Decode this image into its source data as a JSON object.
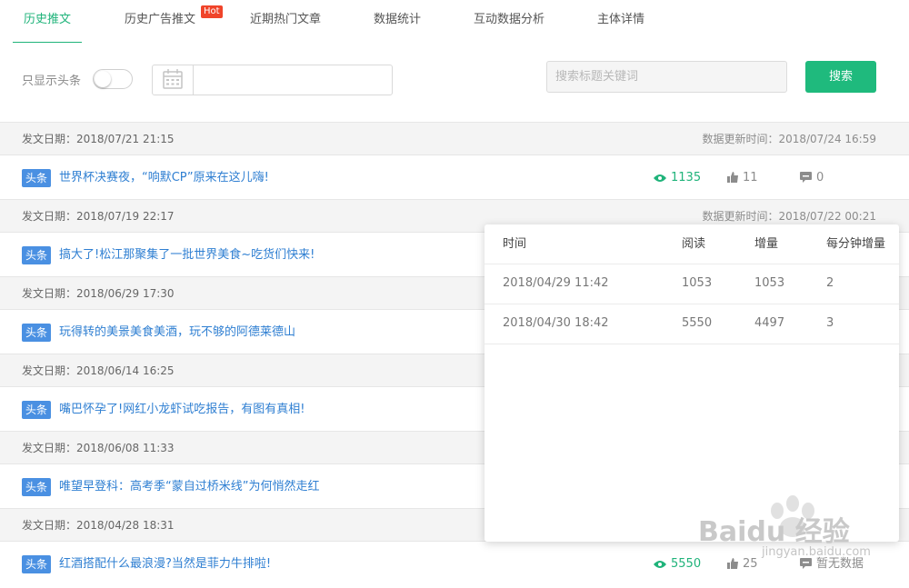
{
  "tabs": [
    {
      "label": "历史推文",
      "active": true
    },
    {
      "label": "历史广告推文",
      "badge": "Hot"
    },
    {
      "label": "近期热门文章"
    },
    {
      "label": "数据统计"
    },
    {
      "label": "互动数据分析"
    },
    {
      "label": "主体详情"
    }
  ],
  "filter": {
    "only_headline_label": "只显示头条",
    "only_headline_on": false,
    "search_placeholder": "搜索标题关键词",
    "search_button": "搜索"
  },
  "articles": [
    {
      "pub_date": "发文日期：2018/07/21 21:15",
      "update": "数据更新时间：2018/07/24 16:59",
      "badge": "头条",
      "title": "世界杯决赛夜，“响默CP”原来在这儿嗨!",
      "reads": "1135",
      "likes": "11",
      "comments": "0"
    },
    {
      "pub_date": "发文日期：2018/07/19 22:17",
      "update": "数据更新时间：2018/07/22 00:21",
      "badge": "头条",
      "title": "搞大了!松江那聚集了一批世界美食~吃货们快来!"
    },
    {
      "pub_date": "发文日期：2018/06/29 17:30",
      "badge": "头条",
      "title": "玩得转的美景美食美酒，玩不够的阿德莱德山"
    },
    {
      "pub_date": "发文日期：2018/06/14 16:25",
      "badge": "头条",
      "title": "嘴巴怀孕了!网红小龙虾试吃报告，有图有真相!"
    },
    {
      "pub_date": "发文日期：2018/06/08 11:33",
      "badge": "头条",
      "title": "唯望早登科：高考季“蒙自过桥米线”为何悄然走红"
    },
    {
      "pub_date": "发文日期：2018/04/28 18:31",
      "badge": "头条",
      "title": "红酒搭配什么最浪漫?当然是菲力牛排啦!",
      "reads": "5550",
      "likes": "25",
      "comments": "暂无数据"
    }
  ],
  "popup": {
    "headers": [
      "时间",
      "阅读",
      "增量",
      "每分钟增量"
    ],
    "rows": [
      [
        "2018/04/29 11:42",
        "1053",
        "1053",
        "2"
      ],
      [
        "2018/04/30 18:42",
        "5550",
        "4497",
        "3"
      ]
    ]
  },
  "watermark": {
    "brand": "Bai",
    "brand2": "du",
    "cn": "经验",
    "url": "jingyan.baidu.com"
  },
  "colors": {
    "accent": "#1fb37a",
    "badge": "#4a90e2",
    "link": "#2f7fd2",
    "hot": "#f0442a"
  }
}
